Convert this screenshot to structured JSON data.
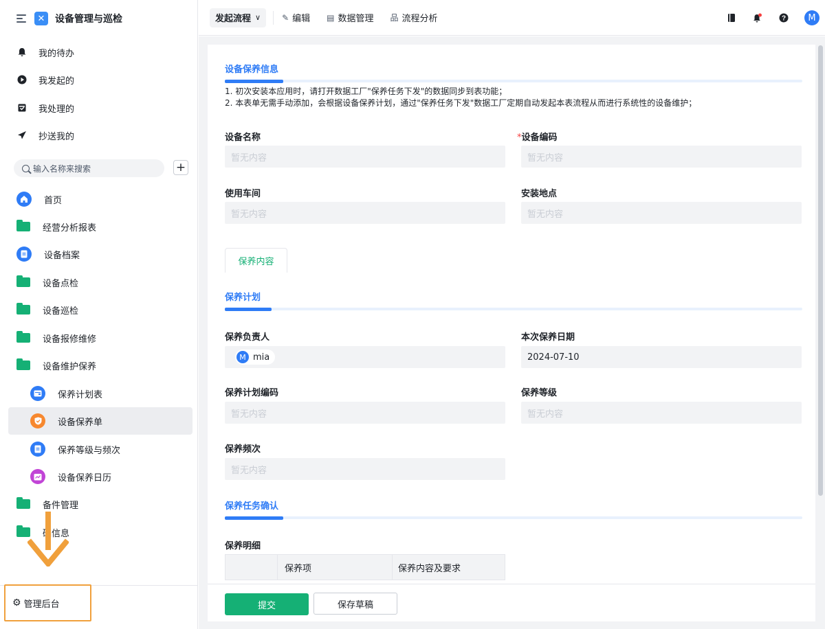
{
  "app": {
    "title": "设备管理与巡检"
  },
  "quick_nav": [
    {
      "label": "我的待办",
      "icon": "bell-icon"
    },
    {
      "label": "我发起的",
      "icon": "play-icon"
    },
    {
      "label": "我处理的",
      "icon": "inbox-icon"
    },
    {
      "label": "抄送我的",
      "icon": "send-icon"
    }
  ],
  "search": {
    "placeholder": "输入名称来搜索"
  },
  "nav": [
    {
      "label": "首页",
      "icon": "home-icon"
    },
    {
      "label": "经营分析报表",
      "icon": "folder-icon"
    },
    {
      "label": "设备档案",
      "icon": "document-icon"
    },
    {
      "label": "设备点检",
      "icon": "folder-icon"
    },
    {
      "label": "设备巡检",
      "icon": "folder-icon"
    },
    {
      "label": "设备报修维修",
      "icon": "folder-icon"
    },
    {
      "label": "设备维护保养",
      "icon": "folder-open-icon"
    },
    {
      "label": "保养计划表",
      "icon": "table-icon"
    },
    {
      "label": "设备保养单",
      "icon": "shield-icon",
      "active": true
    },
    {
      "label": "保养等级与频次",
      "icon": "document-icon"
    },
    {
      "label": "设备保养日历",
      "icon": "calendar-icon"
    },
    {
      "label": "备件管理",
      "icon": "folder-icon"
    },
    {
      "label": "础信息",
      "icon": "folder-icon"
    }
  ],
  "admin": {
    "label": "管理后台"
  },
  "topbar": {
    "flow": "发起流程",
    "edit": "编辑",
    "data": "数据管理",
    "analysis": "流程分析",
    "avatar": "M"
  },
  "form": {
    "section1": {
      "title": "设备保养信息",
      "notes": [
        "1. 初次安装本应用时，请打开数据工厂\"保养任务下发\"的数据同步到表功能；",
        "2. 本表单无需手动添加，会根据设备保养计划，通过\"保养任务下发\"数据工厂定期自动发起本表流程从而进行系统性的设备维护；"
      ]
    },
    "fields1": {
      "device_name_label": "设备名称",
      "device_code_label": "设备编码",
      "workshop_label": "使用车间",
      "location_label": "安装地点",
      "empty": "暂无内容"
    },
    "tab": "保养内容",
    "section2": {
      "title": "保养计划"
    },
    "fields2": {
      "owner_label": "保养负责人",
      "owner_avatar": "M",
      "owner_name": "mia",
      "date_label": "本次保养日期",
      "date_value": "2024-07-10",
      "plan_code_label": "保养计划编码",
      "level_label": "保养等级",
      "freq_label": "保养频次",
      "empty": "暂无内容"
    },
    "section3": {
      "title": "保养任务确认"
    },
    "detail_label": "保养明细",
    "table_headers": [
      "保养项",
      "保养内容及要求"
    ],
    "required_mark": "*"
  },
  "footer": {
    "submit": "提交",
    "draft": "保存草稿"
  },
  "colors": {
    "primary": "#2f7cf6",
    "green": "#15b075",
    "highlight": "#f0a03c"
  }
}
